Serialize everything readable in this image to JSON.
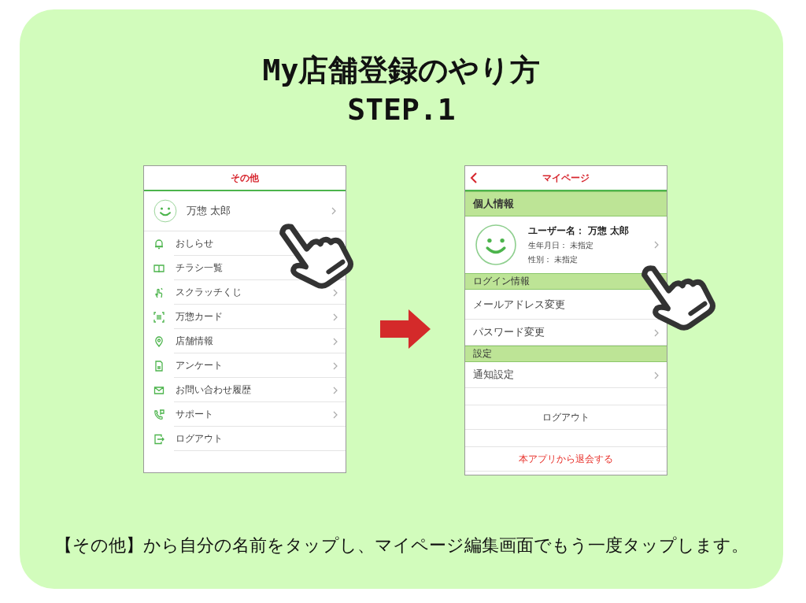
{
  "title": {
    "line1": "My店舗登録のやり方",
    "line2": "STEP.1"
  },
  "screen_left": {
    "header": "その他",
    "profile": {
      "name": "万惣 太郎",
      "has_arrow": true
    },
    "menu": [
      {
        "label": "おしらせ",
        "has_arrow": false
      },
      {
        "label": "チラシ一覧",
        "has_arrow": false
      },
      {
        "label": "スクラッチくじ",
        "has_arrow": true
      },
      {
        "label": "万惣カード",
        "has_arrow": true
      },
      {
        "label": "店舗情報",
        "has_arrow": true
      },
      {
        "label": "アンケート",
        "has_arrow": true
      },
      {
        "label": "お問い合わせ履歴",
        "has_arrow": true
      },
      {
        "label": "サポート",
        "has_arrow": true
      },
      {
        "label": "ログアウト",
        "has_arrow": false
      }
    ]
  },
  "screen_right": {
    "header": "マイページ",
    "sections": [
      {
        "kind": "band",
        "label": "個人情報"
      },
      {
        "kind": "profile",
        "username_label": "ユーザー名：",
        "username": "万惣 太郎",
        "birthday_label": "生年月日：",
        "birthday": "未指定",
        "gender_label": "性別：",
        "gender": "未指定",
        "has_arrow": true
      },
      {
        "kind": "subband",
        "label": "ログイン情報"
      },
      {
        "kind": "row",
        "label": "メールアドレス変更",
        "has_arrow": false
      },
      {
        "kind": "row",
        "label": "パスワード変更",
        "has_arrow": true
      },
      {
        "kind": "subband",
        "label": "設定"
      },
      {
        "kind": "row",
        "label": "通知設定",
        "has_arrow": true
      },
      {
        "kind": "gap"
      },
      {
        "kind": "action",
        "label": "ログアウト",
        "danger": false
      },
      {
        "kind": "gap"
      },
      {
        "kind": "action",
        "label": "本アプリから退会する",
        "danger": true
      }
    ]
  },
  "caption": "【その他】から自分の名前をタップし、マイページ編集画面でもう一度タップします。"
}
